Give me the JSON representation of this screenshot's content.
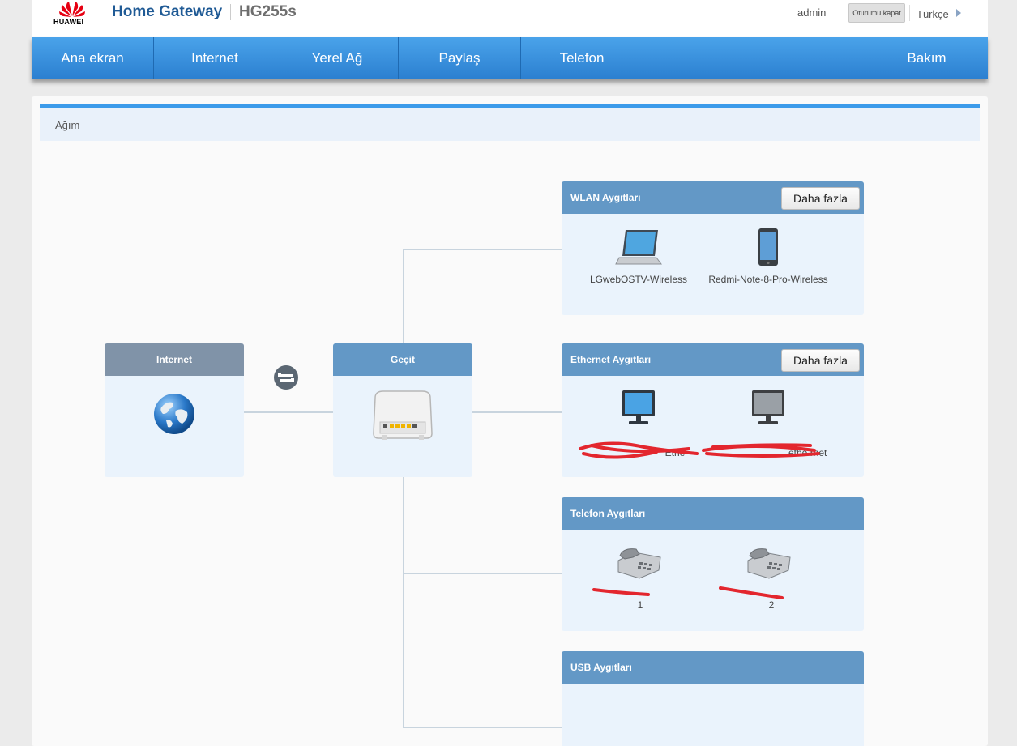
{
  "header": {
    "brand": "HUAWEI",
    "product": "Home Gateway",
    "model": "HG255s",
    "user": "admin",
    "logout_label": "Oturumu kapat",
    "language": "Türkçe"
  },
  "nav": {
    "items": [
      {
        "label": "Ana ekran"
      },
      {
        "label": "Internet"
      },
      {
        "label": "Yerel Ağ"
      },
      {
        "label": "Paylaş"
      },
      {
        "label": "Telefon"
      },
      {
        "label": "Bakım"
      }
    ]
  },
  "page": {
    "breadcrumb": "Ağım"
  },
  "topology": {
    "internet": {
      "title": "Internet"
    },
    "gateway": {
      "title": "Geçit"
    },
    "wlan": {
      "title": "WLAN Aygıtları",
      "more_label": "Daha fazla",
      "devices": [
        {
          "label": "LGwebOSTV-Wireless",
          "icon": "laptop-icon"
        },
        {
          "label": "Redmi-Note-8-Pro-Wireless",
          "icon": "phone-icon"
        }
      ]
    },
    "ethernet": {
      "title": "Ethernet Aygıtları",
      "more_label": "Daha fazla",
      "devices": [
        {
          "label": "Ethe",
          "icon": "monitor-icon"
        },
        {
          "label": "ethe rnet",
          "icon": "monitor-icon"
        }
      ]
    },
    "phone": {
      "title": "Telefon Aygıtları",
      "devices": [
        {
          "label": "1",
          "icon": "telephone-icon"
        },
        {
          "label": "2",
          "icon": "telephone-icon"
        }
      ]
    },
    "usb": {
      "title": "USB Aygıtları"
    }
  },
  "colors": {
    "nav_blue": "#2b7fd0",
    "box_header": "#6398c6",
    "internet_header": "#8093a8",
    "brand_red": "#e60012"
  }
}
